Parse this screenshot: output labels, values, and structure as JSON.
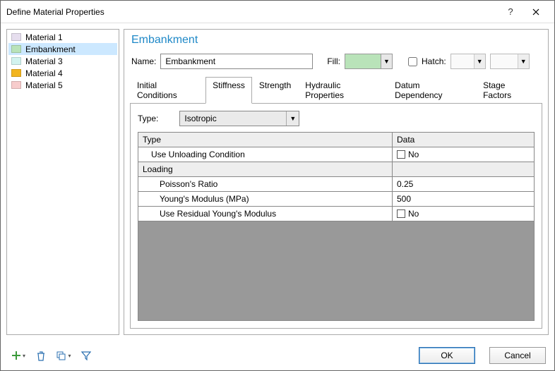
{
  "window": {
    "title": "Define Material Properties"
  },
  "materials": [
    {
      "name": "Material 1",
      "color": "#e6deee",
      "selected": false
    },
    {
      "name": "Embankment",
      "color": "#b9e3b9",
      "selected": true
    },
    {
      "name": "Material 3",
      "color": "#d2f3ef",
      "selected": false
    },
    {
      "name": "Material 4",
      "color": "#f2b51f",
      "selected": false
    },
    {
      "name": "Material 5",
      "color": "#f7cccc",
      "selected": false
    }
  ],
  "main": {
    "title": "Embankment",
    "name_label": "Name:",
    "name_value": "Embankment",
    "fill_label": "Fill:",
    "fill_color": "#b9e3b9",
    "hatch_label": "Hatch:"
  },
  "tabs": [
    {
      "label": "Initial Conditions",
      "active": false
    },
    {
      "label": "Stiffness",
      "active": true
    },
    {
      "label": "Strength",
      "active": false
    },
    {
      "label": "Hydraulic Properties",
      "active": false
    },
    {
      "label": "Datum Dependency",
      "active": false
    },
    {
      "label": "Stage Factors",
      "active": false
    }
  ],
  "stiffness": {
    "type_label": "Type:",
    "type_value": "Isotropic",
    "columns": {
      "type": "Type",
      "data": "Data"
    },
    "rows": [
      {
        "kind": "row",
        "label": "Use Unloading Condition",
        "indent": 1,
        "dataKind": "bool",
        "data": "No"
      },
      {
        "kind": "section",
        "label": "Loading"
      },
      {
        "kind": "row",
        "label": "Poisson's Ratio",
        "indent": 2,
        "dataKind": "text",
        "data": "0.25"
      },
      {
        "kind": "row",
        "label": "Young's Modulus (MPa)",
        "indent": 2,
        "dataKind": "text",
        "data": "500"
      },
      {
        "kind": "row",
        "label": "Use Residual Young's Modulus",
        "indent": 2,
        "dataKind": "bool",
        "data": "No"
      }
    ]
  },
  "footer": {
    "ok": "OK",
    "cancel": "Cancel"
  },
  "icons": {
    "plus_color": "#3a9a3a",
    "trash_color": "#2a6fb0",
    "copy_color": "#2a6fb0",
    "filter_color": "#2a6fb0"
  }
}
